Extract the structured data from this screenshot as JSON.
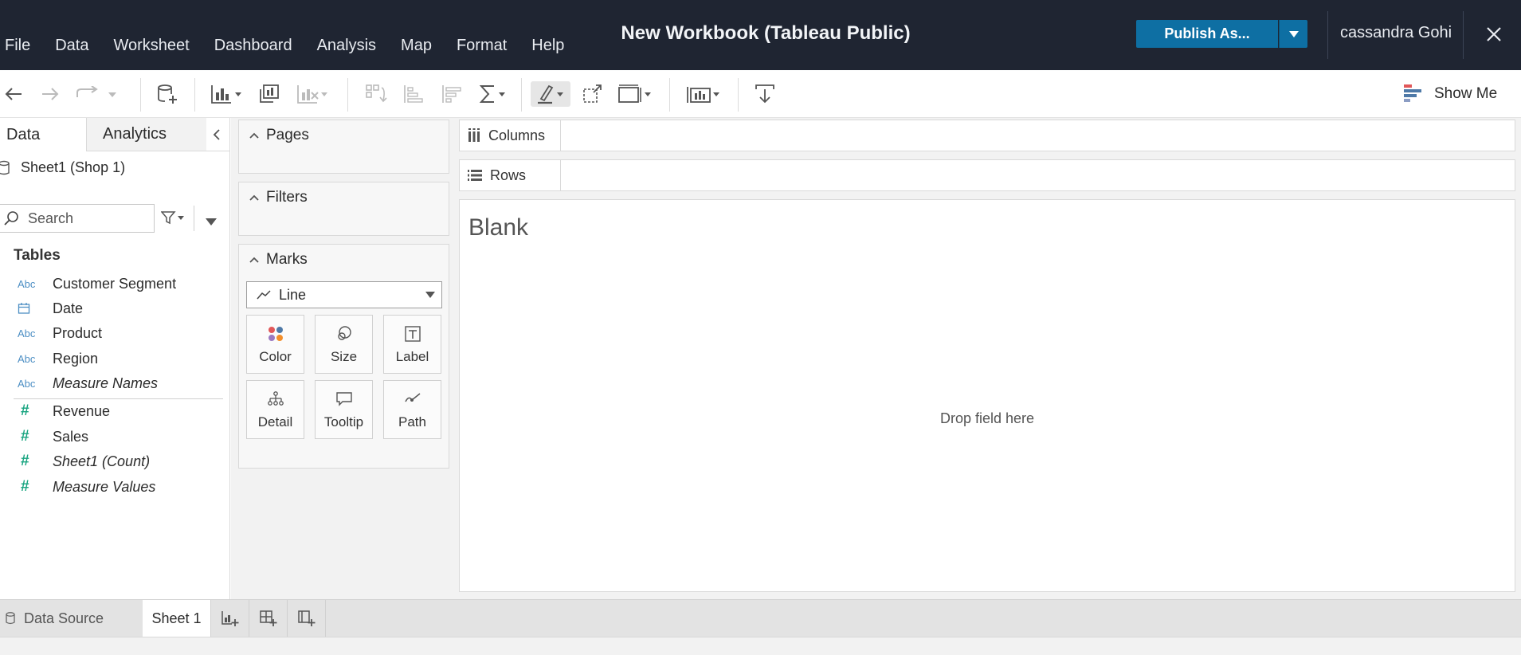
{
  "app": {
    "title": "New Workbook (Tableau Public)",
    "accent": "#0e6fa3",
    "header_bg": "#1f2532"
  },
  "menu": [
    "File",
    "Data",
    "Worksheet",
    "Dashboard",
    "Analysis",
    "Map",
    "Format",
    "Help"
  ],
  "header": {
    "publish_label": "Publish As...",
    "user_name": "cassandra Gohi"
  },
  "toolbar": {
    "show_me_label": "Show Me",
    "icons": [
      "back-icon",
      "forward-icon",
      "redo-icon",
      "new-datasource-icon",
      "new-worksheet-icon",
      "duplicate-icon",
      "clear-sheet-icon",
      "swap-icon",
      "sort-ascending-icon",
      "sort-descending-icon",
      "aggregate-icon",
      "highlight-icon",
      "group-icon",
      "fit-icon",
      "presentation-icon",
      "download-icon"
    ]
  },
  "data_pane": {
    "tabs": [
      "Data",
      "Analytics"
    ],
    "datasource": "Sheet1 (Shop 1)",
    "search_placeholder": "Search",
    "tables_header": "Tables",
    "dimensions": [
      {
        "icon": "Abc",
        "name": "Customer Segment"
      },
      {
        "icon": "date",
        "name": "Date"
      },
      {
        "icon": "Abc",
        "name": "Product"
      },
      {
        "icon": "Abc",
        "name": "Region"
      },
      {
        "icon": "Abc",
        "name": "Measure Names",
        "italic": true
      }
    ],
    "measures": [
      {
        "icon": "#",
        "name": "Revenue"
      },
      {
        "icon": "#",
        "name": "Sales"
      },
      {
        "icon": "#",
        "name": "Sheet1 (Count)",
        "italic": true
      },
      {
        "icon": "#",
        "name": "Measure Values",
        "italic": true
      }
    ]
  },
  "cards": {
    "pages": "Pages",
    "filters": "Filters",
    "marks": "Marks",
    "mark_type": "Line",
    "mark_buttons": [
      "Color",
      "Size",
      "Label",
      "Detail",
      "Tooltip",
      "Path"
    ]
  },
  "shelves": {
    "columns": "Columns",
    "rows": "Rows"
  },
  "view": {
    "title": "Blank",
    "drop_hint": "Drop field here"
  },
  "bottom": {
    "datasource_tab": "Data Source",
    "sheet_tab": "Sheet 1"
  }
}
